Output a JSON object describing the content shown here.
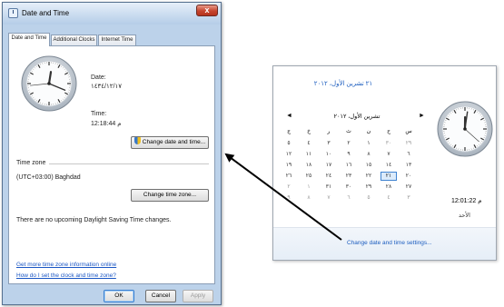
{
  "dialog": {
    "title": "Date and Time",
    "close_glyph": "x",
    "tabs": [
      {
        "label": "Date and Time",
        "active": true
      },
      {
        "label": "Additional Clocks",
        "active": false
      },
      {
        "label": "Internet Time",
        "active": false
      }
    ],
    "date_label": "Date:",
    "date_value": "١٤٣٤/١٢/١٧",
    "time_label": "Time:",
    "time_value": "12:18:44 م",
    "change_datetime_button": "Change date and time...",
    "timezone_label": "Time zone",
    "timezone_value": "(UTC+03:00) Baghdad",
    "change_timezone_button": "Change time zone...",
    "dst_message": "There are no upcoming Daylight Saving Time changes.",
    "link_more_info": "Get more time zone information online",
    "link_how_set": "How do I set the clock and time zone?",
    "ok_button": "OK",
    "cancel_button": "Cancel",
    "apply_button": "Apply",
    "clock": {
      "hour": 12,
      "minute": 18,
      "second": 44
    }
  },
  "flyout": {
    "date_link": "٢١ تشرين الأول، ٢٠١٢",
    "prev_arrow": "◄",
    "next_arrow": "►",
    "month_label": "تشرين الأول، ٢٠١٢",
    "weekdays": [
      "ج",
      "خ",
      "ر",
      "ث",
      "ن",
      "ح",
      "س"
    ],
    "rows": [
      [
        {
          "t": "٥",
          "s": "cur"
        },
        {
          "t": "٤",
          "s": "cur"
        },
        {
          "t": "٣",
          "s": "cur"
        },
        {
          "t": "٢",
          "s": "cur"
        },
        {
          "t": "١",
          "s": "cur"
        },
        {
          "t": "٣٠",
          "s": "dim"
        },
        {
          "t": "٢٩",
          "s": "dim"
        }
      ],
      [
        {
          "t": "١٢",
          "s": "cur"
        },
        {
          "t": "١١",
          "s": "cur"
        },
        {
          "t": "١٠",
          "s": "cur"
        },
        {
          "t": "٩",
          "s": "cur"
        },
        {
          "t": "٨",
          "s": "cur"
        },
        {
          "t": "٧",
          "s": "cur"
        },
        {
          "t": "٦",
          "s": "cur"
        }
      ],
      [
        {
          "t": "١٩",
          "s": "cur"
        },
        {
          "t": "١٨",
          "s": "cur"
        },
        {
          "t": "١٧",
          "s": "cur"
        },
        {
          "t": "١٦",
          "s": "cur"
        },
        {
          "t": "١٥",
          "s": "cur"
        },
        {
          "t": "١٤",
          "s": "cur"
        },
        {
          "t": "١٣",
          "s": "cur"
        }
      ],
      [
        {
          "t": "٢٦",
          "s": "cur"
        },
        {
          "t": "٢٥",
          "s": "cur"
        },
        {
          "t": "٢٤",
          "s": "cur"
        },
        {
          "t": "٢٣",
          "s": "cur"
        },
        {
          "t": "٢٢",
          "s": "cur"
        },
        {
          "t": "٢١",
          "s": "today"
        },
        {
          "t": "٢٠",
          "s": "cur"
        }
      ],
      [
        {
          "t": "٢",
          "s": "dim"
        },
        {
          "t": "١",
          "s": "dim"
        },
        {
          "t": "٣١",
          "s": "cur"
        },
        {
          "t": "٣٠",
          "s": "cur"
        },
        {
          "t": "٢٩",
          "s": "cur"
        },
        {
          "t": "٢٨",
          "s": "cur"
        },
        {
          "t": "٢٧",
          "s": "cur"
        }
      ],
      [
        {
          "t": "٩",
          "s": "dim"
        },
        {
          "t": "٨",
          "s": "dim"
        },
        {
          "t": "٧",
          "s": "dim"
        },
        {
          "t": "٦",
          "s": "dim"
        },
        {
          "t": "٥",
          "s": "dim"
        },
        {
          "t": "٤",
          "s": "dim"
        },
        {
          "t": "٣",
          "s": "dim"
        }
      ]
    ],
    "time_value": "12:01:22 م",
    "day_name": "الأحد",
    "settings_link": "Change date and time settings...",
    "clock": {
      "hour": 12,
      "minute": 1,
      "second": 22
    }
  },
  "colors": {
    "link": "#1c5dbf",
    "accent": "#3f82d0",
    "arrow": "#000000"
  }
}
